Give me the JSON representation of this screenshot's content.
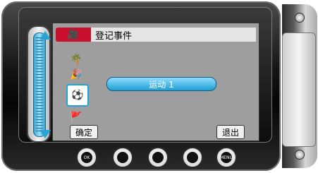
{
  "header": {
    "title": "登记事件",
    "icon": "camera-icon"
  },
  "categories": [
    {
      "name": "palm-tree-icon",
      "glyph": "🌴"
    },
    {
      "name": "party-icon",
      "glyph": "🎉"
    },
    {
      "name": "sports-icon",
      "glyph": "⚽"
    },
    {
      "name": "flag-icon",
      "glyph": "🚩"
    }
  ],
  "selected_value": "运动 1",
  "softkeys": {
    "ok": "确定",
    "exit": "退出"
  },
  "buttons": {
    "ok": "OK",
    "menu": "MENU"
  },
  "colors": {
    "accent": "#1da7d6",
    "header_icon_bg": "#c8102e"
  }
}
